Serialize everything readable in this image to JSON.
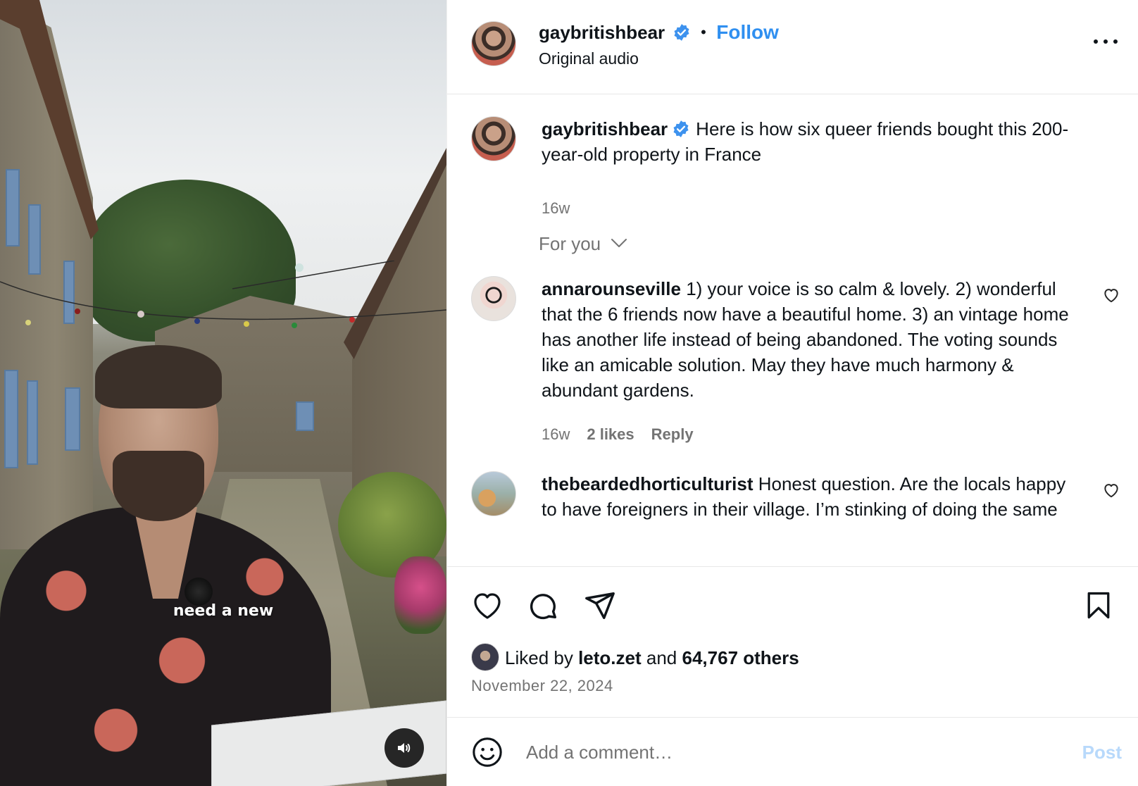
{
  "video": {
    "caption": "need a new"
  },
  "header": {
    "username": "gaybritishbear",
    "separator": "•",
    "follow_label": "Follow",
    "audio_label": "Original audio"
  },
  "post": {
    "username": "gaybritishbear",
    "caption": "Here is how six queer friends bought this 200-year-old property in France",
    "age": "16w"
  },
  "filter": {
    "label": "For you"
  },
  "comments": [
    {
      "username": "annarounseville",
      "text": "1) your voice is so calm & lovely. 2) wonderful that the 6 friends now have a beautiful home. 3) an vintage home has another life instead of being abandoned. The voting sounds like an amicable solution. May they have much harmony & abundant gardens.",
      "age": "16w",
      "likes": "2 likes",
      "reply_label": "Reply"
    },
    {
      "username": "thebeardedhorticulturist",
      "text": "Honest question. Are the locals happy to have foreigners in their village. I’m stinking of doing the same",
      "age": "",
      "likes": "",
      "reply_label": ""
    }
  ],
  "likes_summary": {
    "prefix": "Liked by",
    "user": "leto.zet",
    "middle": "and",
    "count": "64,767 others"
  },
  "date": "November 22, 2024",
  "composer": {
    "placeholder": "Add a comment…",
    "post_label": "Post"
  },
  "colors": {
    "accent": "#2f8ff0",
    "muted": "#737373",
    "post_disabled": "#b8d9fb"
  },
  "icons": {
    "verified": "verified-badge-icon",
    "more": "more-options-icon",
    "heart": "heart-icon",
    "comment": "comment-icon",
    "share": "paper-plane-icon",
    "save": "bookmark-icon",
    "emoji": "emoji-icon",
    "sound": "speaker-icon",
    "chevron": "chevron-down-icon"
  }
}
